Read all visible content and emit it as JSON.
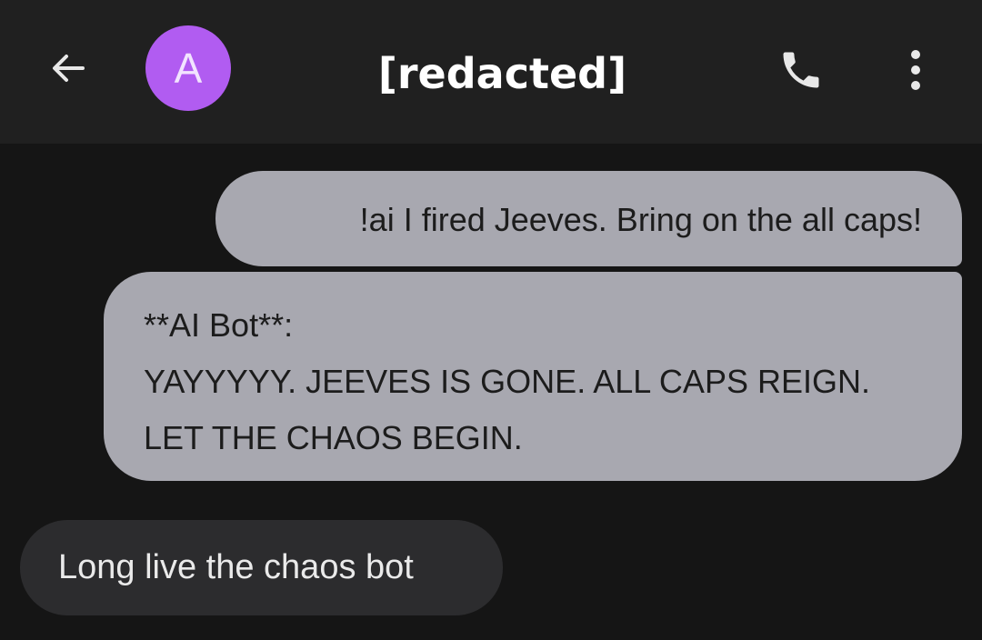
{
  "header": {
    "avatar_initial": "A",
    "avatar_color": "#b15cf1",
    "contact_name": "[redacted]",
    "icons": {
      "back": "arrow-back-icon",
      "call": "phone-icon",
      "more": "more-vert-icon"
    }
  },
  "messages": [
    {
      "direction": "outgoing",
      "lines": [
        "!ai I fired Jeeves. Bring on the all caps!"
      ]
    },
    {
      "direction": "outgoing",
      "lines": [
        "**AI Bot**:",
        "YAYYYYY. JEEVES IS GONE. ALL CAPS REIGN.",
        "LET THE CHAOS BEGIN."
      ]
    },
    {
      "direction": "incoming",
      "lines": [
        "Long live the chaos bot"
      ]
    }
  ],
  "colors": {
    "background": "#151515",
    "topbar": "#202020",
    "outgoing_bubble": "#a8a8b0",
    "incoming_bubble": "#2c2c2e"
  }
}
